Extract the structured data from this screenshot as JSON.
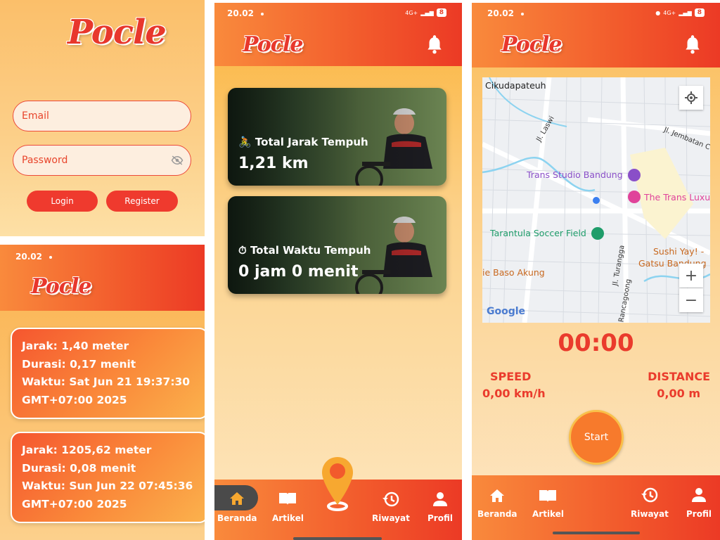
{
  "brand": {
    "logo": "Pocle"
  },
  "status": {
    "time": "20.02",
    "battery": "8",
    "network": "4G+"
  },
  "login": {
    "email_placeholder": "Email",
    "password_placeholder": "Password",
    "login_label": "Login",
    "register_label": "Register"
  },
  "history": {
    "records": [
      {
        "jarak": "Jarak: 1,40 meter",
        "durasi": "Durasi: 0,17 menit",
        "waktu1": "Waktu: Sat Jun 21 19:37:30",
        "waktu2": "GMT+07:00 2025"
      },
      {
        "jarak": "Jarak: 1205,62 meter",
        "durasi": "Durasi: 0,08 menit",
        "waktu1": "Waktu: Sun Jun 22 07:45:36",
        "waktu2": "GMT+07:00 2025"
      }
    ]
  },
  "home": {
    "cards": [
      {
        "emoji": "🚴",
        "title": "Total Jarak Tempuh",
        "value": "1,21 km"
      },
      {
        "emoji": "⏱",
        "title": "Total Waktu Tempuh",
        "value": "0 jam 0 menit"
      }
    ]
  },
  "nav": {
    "beranda": "Beranda",
    "artikel": "Artikel",
    "riwayat": "Riwayat",
    "profil": "Profil"
  },
  "tracker": {
    "timer": "00:00",
    "speed_label": "SPEED",
    "speed_value": "0,00 km/h",
    "distance_label": "DISTANCE",
    "distance_value": "0,00 m",
    "start_label": "Start",
    "map": {
      "labels": {
        "cikudapateuh": "Cikudapateuh",
        "laswi": "Jl. Laswi",
        "jembatan": "Jl. Jembatan C",
        "trans_studio": "Trans Studio Bandung",
        "trans_luxury": "The Trans Luxu",
        "tarantula": "Tarantula Soccer Field",
        "sushi1": "Sushi Yay! -",
        "sushi2": "Gatsu Bandung",
        "baso": "ie Baso Akung",
        "turangga": "Jl. Turangga",
        "rancagoong": "Jl. Rancagoong",
        "google": "Google"
      },
      "zoom_in": "+",
      "zoom_out": "−"
    }
  },
  "colors": {
    "accent": "#ef3a2e",
    "orange": "#f98a3c",
    "purple": "#8a4fc8",
    "pink": "#e0439a",
    "green": "#1f9d6a"
  }
}
